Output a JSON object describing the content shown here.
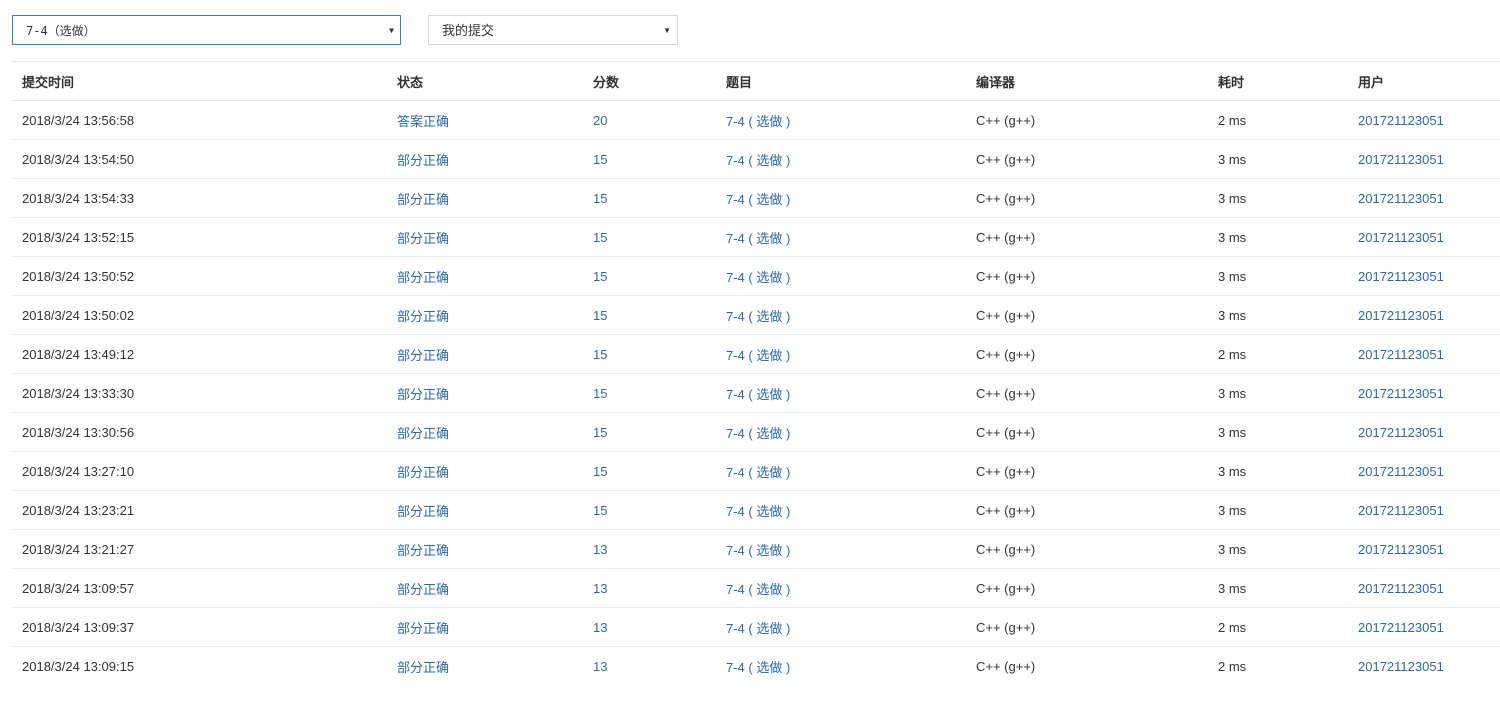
{
  "filters": {
    "problem_select": "7-4（选做）",
    "scope_select": "我的提交"
  },
  "table": {
    "headers": {
      "time": "提交时间",
      "status": "状态",
      "score": "分数",
      "problem": "题目",
      "compiler": "编译器",
      "cost": "耗时",
      "user": "用户"
    },
    "rows": [
      {
        "time": "2018/3/24 13:56:58",
        "status": "答案正确",
        "status_kind": "ok",
        "score": "20",
        "problem": "7-4 ( 选做 )",
        "compiler": "C++ (g++)",
        "cost": "2 ms",
        "user": "201721123051"
      },
      {
        "time": "2018/3/24 13:54:50",
        "status": "部分正确",
        "status_kind": "partial",
        "score": "15",
        "problem": "7-4 ( 选做 )",
        "compiler": "C++ (g++)",
        "cost": "3 ms",
        "user": "201721123051"
      },
      {
        "time": "2018/3/24 13:54:33",
        "status": "部分正确",
        "status_kind": "partial",
        "score": "15",
        "problem": "7-4 ( 选做 )",
        "compiler": "C++ (g++)",
        "cost": "3 ms",
        "user": "201721123051"
      },
      {
        "time": "2018/3/24 13:52:15",
        "status": "部分正确",
        "status_kind": "partial",
        "score": "15",
        "problem": "7-4 ( 选做 )",
        "compiler": "C++ (g++)",
        "cost": "3 ms",
        "user": "201721123051"
      },
      {
        "time": "2018/3/24 13:50:52",
        "status": "部分正确",
        "status_kind": "partial",
        "score": "15",
        "problem": "7-4 ( 选做 )",
        "compiler": "C++ (g++)",
        "cost": "3 ms",
        "user": "201721123051"
      },
      {
        "time": "2018/3/24 13:50:02",
        "status": "部分正确",
        "status_kind": "partial",
        "score": "15",
        "problem": "7-4 ( 选做 )",
        "compiler": "C++ (g++)",
        "cost": "3 ms",
        "user": "201721123051"
      },
      {
        "time": "2018/3/24 13:49:12",
        "status": "部分正确",
        "status_kind": "partial",
        "score": "15",
        "problem": "7-4 ( 选做 )",
        "compiler": "C++ (g++)",
        "cost": "2 ms",
        "user": "201721123051"
      },
      {
        "time": "2018/3/24 13:33:30",
        "status": "部分正确",
        "status_kind": "partial",
        "score": "15",
        "problem": "7-4 ( 选做 )",
        "compiler": "C++ (g++)",
        "cost": "3 ms",
        "user": "201721123051"
      },
      {
        "time": "2018/3/24 13:30:56",
        "status": "部分正确",
        "status_kind": "partial",
        "score": "15",
        "problem": "7-4 ( 选做 )",
        "compiler": "C++ (g++)",
        "cost": "3 ms",
        "user": "201721123051"
      },
      {
        "time": "2018/3/24 13:27:10",
        "status": "部分正确",
        "status_kind": "partial",
        "score": "15",
        "problem": "7-4 ( 选做 )",
        "compiler": "C++ (g++)",
        "cost": "3 ms",
        "user": "201721123051"
      },
      {
        "time": "2018/3/24 13:23:21",
        "status": "部分正确",
        "status_kind": "partial",
        "score": "15",
        "problem": "7-4 ( 选做 )",
        "compiler": "C++ (g++)",
        "cost": "3 ms",
        "user": "201721123051"
      },
      {
        "time": "2018/3/24 13:21:27",
        "status": "部分正确",
        "status_kind": "partial",
        "score": "13",
        "problem": "7-4 ( 选做 )",
        "compiler": "C++ (g++)",
        "cost": "3 ms",
        "user": "201721123051"
      },
      {
        "time": "2018/3/24 13:09:57",
        "status": "部分正确",
        "status_kind": "partial",
        "score": "13",
        "problem": "7-4 ( 选做 )",
        "compiler": "C++ (g++)",
        "cost": "3 ms",
        "user": "201721123051"
      },
      {
        "time": "2018/3/24 13:09:37",
        "status": "部分正确",
        "status_kind": "partial",
        "score": "13",
        "problem": "7-4 ( 选做 )",
        "compiler": "C++ (g++)",
        "cost": "2 ms",
        "user": "201721123051"
      },
      {
        "time": "2018/3/24 13:09:15",
        "status": "部分正确",
        "status_kind": "partial",
        "score": "13",
        "problem": "7-4 ( 选做 )",
        "compiler": "C++ (g++)",
        "cost": "2 ms",
        "user": "201721123051"
      }
    ]
  },
  "colors": {
    "accepted": "#d9534f",
    "partial": "#4cae4c",
    "link": "#2b6aa8",
    "focus_border": "#3b7fc4"
  },
  "icons": {
    "dropdown": "caret-down-icon"
  }
}
